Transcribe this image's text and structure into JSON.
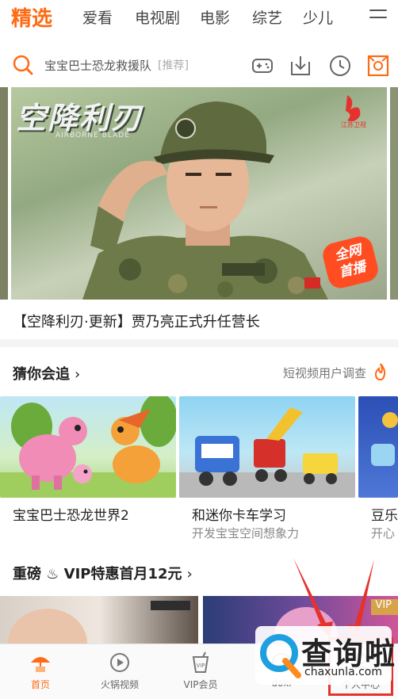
{
  "topnav": {
    "tabs": [
      {
        "label": "精选",
        "active": true
      },
      {
        "label": "爱看"
      },
      {
        "label": "电视剧"
      },
      {
        "label": "电影"
      },
      {
        "label": "综艺"
      },
      {
        "label": "少儿"
      }
    ],
    "more_icon": "menu-icon"
  },
  "search": {
    "query": "宝宝巴士恐龙救援队",
    "tag": "[推荐]",
    "icon": "search-icon",
    "tools": [
      "gamepad-icon",
      "download-icon",
      "history-icon",
      "scan-icon"
    ],
    "accent": "#ff6a13"
  },
  "hero": {
    "logo_text": "空降利刃",
    "logo_sub": "AIRBORNE BLADE",
    "channel": "江苏卫视",
    "badge_line1": "全网",
    "badge_line2": "首播",
    "caption": "【空降利刃·更新】贾乃亮正式升任营长"
  },
  "section_follow": {
    "title": "猜你会追",
    "arrow": "›",
    "right_text": "短视频用户调查",
    "cards": [
      {
        "title": "宝宝巴士恐龙世界2",
        "subtitle": ""
      },
      {
        "title": "和迷你卡车学习",
        "subtitle": "开发宝宝空间想象力"
      },
      {
        "title": "豆乐",
        "subtitle": "开心"
      }
    ]
  },
  "section_vip": {
    "title": "重磅 ♨ VIP特惠首月12元",
    "arrow": "›",
    "vip_tag": "VIP"
  },
  "tabbar": {
    "items": [
      {
        "label": "首页",
        "icon": "home-umbrella-icon",
        "active": true
      },
      {
        "label": "火锅视频",
        "icon": "play-circle-icon"
      },
      {
        "label": "VIP会员",
        "icon": "vip-cup-icon"
      },
      {
        "label": "doki",
        "icon": "doki-icon"
      },
      {
        "label": "个人中心",
        "icon": "user-icon"
      }
    ]
  },
  "watermark": {
    "big": "查询啦",
    "small": "chaxunla.com"
  }
}
